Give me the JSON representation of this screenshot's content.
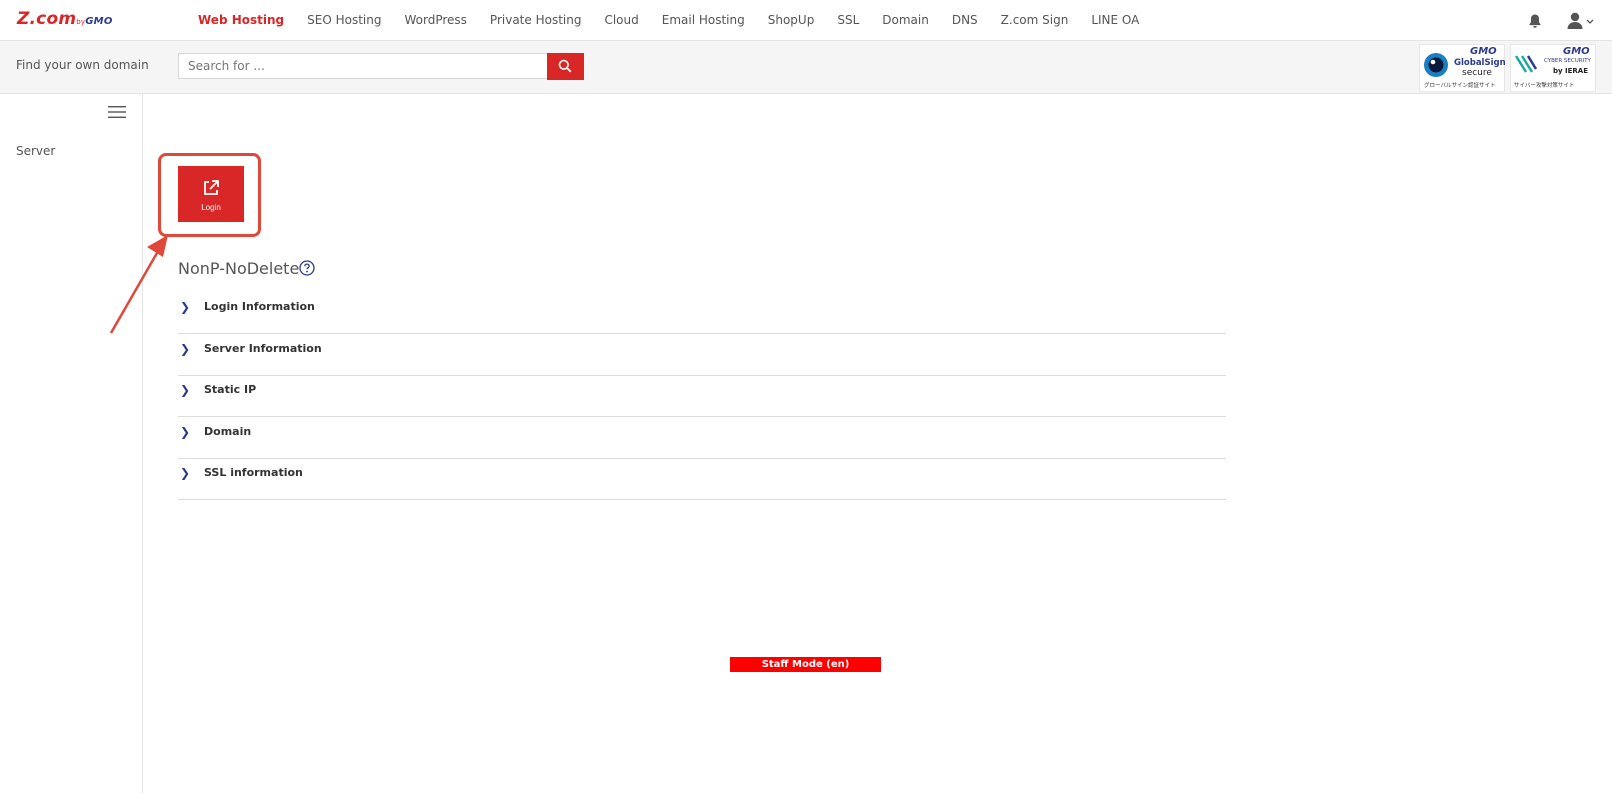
{
  "header": {
    "logo_main": "Z.com",
    "logo_by": "by",
    "logo_gmo": "GMO",
    "nav": [
      {
        "label": "Web Hosting",
        "active": true
      },
      {
        "label": "SEO Hosting",
        "active": false
      },
      {
        "label": "WordPress",
        "active": false
      },
      {
        "label": "Private Hosting",
        "active": false
      },
      {
        "label": "Cloud",
        "active": false
      },
      {
        "label": "Email Hosting",
        "active": false
      },
      {
        "label": "ShopUp",
        "active": false
      },
      {
        "label": "SSL",
        "active": false
      },
      {
        "label": "Domain",
        "active": false
      },
      {
        "label": "DNS",
        "active": false
      },
      {
        "label": "Z.com Sign",
        "active": false
      },
      {
        "label": "LINE OA",
        "active": false
      }
    ],
    "icons": {
      "notification": "bell-icon",
      "account": "user-icon"
    }
  },
  "search": {
    "label": "Find your own domain",
    "placeholder": "Search for ...",
    "icon": "search-icon"
  },
  "badges": {
    "globalsign": {
      "gmo": "GMO",
      "line1": "GlobalSign",
      "line2": "secure",
      "caption": "グローバルサイン認証サイト"
    },
    "cybersecurity": {
      "gmo": "GMO",
      "line1": "CYBER SECURITY",
      "line2": "by IERAE",
      "caption": "サイバー攻撃対策サイト"
    }
  },
  "sidebar": {
    "menu_icon": "hamburger-icon",
    "items": [
      {
        "label": "Server"
      }
    ]
  },
  "main": {
    "login_button": {
      "label": "Login",
      "icon": "external-link-icon"
    },
    "server_name": "NonP-NoDelete",
    "help_icon": "question-circle-icon",
    "sections": [
      {
        "label": "Login Information"
      },
      {
        "label": "Server Information"
      },
      {
        "label": "Static IP"
      },
      {
        "label": "Domain"
      },
      {
        "label": "SSL information"
      }
    ],
    "staff_mode": "Staff Mode (en)"
  },
  "colors": {
    "brand_red": "#d92727",
    "navy": "#2b3a8c",
    "highlight": "#e0483a",
    "staff_bg": "#ff0000"
  }
}
